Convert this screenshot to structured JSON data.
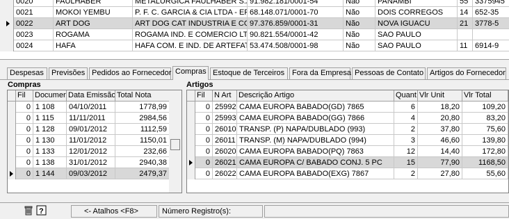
{
  "top_grid": {
    "rows": [
      {
        "code": "0020",
        "name": "FAULHABER",
        "razao": "METALURGICA FAULHABER S.A.",
        "cnpj": "91.982.181/0001-54",
        "flag": "Não",
        "city": "PANAMBI",
        "num": "55",
        "phone": "3375945",
        "selected": false
      },
      {
        "code": "0021",
        "name": "MOKOI YEMBU",
        "razao": "P. F. C. GARCIA & CIA LTDA - EPP",
        "cnpj": "68.148.071/0001-70",
        "flag": "Não",
        "city": "DOIS CORREGOS",
        "num": "14",
        "phone": "652-35",
        "selected": false
      },
      {
        "code": "0022",
        "name": "ART DOG",
        "razao": "ART DOG CAT INDUSTRIA E COMER",
        "cnpj": "97.376.859/0001-31",
        "flag": "Não",
        "city": "NOVA IGUACU",
        "num": "21",
        "phone": "3778-5",
        "selected": true
      },
      {
        "code": "0023",
        "name": "ROGAMA",
        "razao": "ROGAMA IND. E COMERCIO LTDA",
        "cnpj": "90.821.554/0001-42",
        "flag": "Não",
        "city": "SAO PAULO",
        "num": "",
        "phone": "",
        "selected": false
      },
      {
        "code": "0024",
        "name": "HAFA",
        "razao": "HAFA COM. E IND. DE ARTEFATOS D",
        "cnpj": "53.474.508/0001-98",
        "flag": "Não",
        "city": "SAO PAULO",
        "num": "11",
        "phone": "6914-9",
        "selected": false
      }
    ]
  },
  "tabs": [
    {
      "label": "Despesas",
      "active": false
    },
    {
      "label": "Previsões",
      "active": false
    },
    {
      "label": "Pedidos ao Fornecedor",
      "active": false
    },
    {
      "label": "Compras",
      "active": true
    },
    {
      "label": "Estoque de Terceiros",
      "active": false
    },
    {
      "label": "Fora da Empresa",
      "active": false
    },
    {
      "label": "Pessoas de Contato",
      "active": false
    },
    {
      "label": "Artigos do Fornecedor",
      "active": false
    }
  ],
  "compras": {
    "title": "Compras",
    "headers": {
      "fil": "Fil",
      "doc": "Documer",
      "data": "Data Emissão",
      "total": "Total Nota"
    },
    "rows": [
      {
        "fil": "0",
        "doc": "1 108",
        "data": "04/10/2011",
        "total": "1778,99",
        "selected": false
      },
      {
        "fil": "0",
        "doc": "1 115",
        "data": "11/11/2011",
        "total": "2984,56",
        "selected": false
      },
      {
        "fil": "0",
        "doc": "1 128",
        "data": "09/01/2012",
        "total": "1112,59",
        "selected": false
      },
      {
        "fil": "0",
        "doc": "1 130",
        "data": "11/01/2012",
        "total": "1150,01",
        "selected": false
      },
      {
        "fil": "0",
        "doc": "1 133",
        "data": "12/01/2012",
        "total": "232,66",
        "selected": false
      },
      {
        "fil": "0",
        "doc": "1 138",
        "data": "31/01/2012",
        "total": "2940,38",
        "selected": false
      },
      {
        "fil": "0",
        "doc": "1 144",
        "data": "09/03/2012",
        "total": "2479,37",
        "selected": true
      }
    ]
  },
  "artigos": {
    "title": "Artigos",
    "headers": {
      "fil": "Fil",
      "nart": "N Art",
      "desc": "Descrição Artigo",
      "quant": "Quant",
      "unit": "Vlr Unit",
      "total": "Vlr Total"
    },
    "rows": [
      {
        "fil": "0",
        "nart": "25992",
        "desc": "CAMA EUROPA BABADO(GD) 7865",
        "quant": "6",
        "unit": "18,20",
        "total": "109,20",
        "selected": false
      },
      {
        "fil": "0",
        "nart": "25993",
        "desc": "CAMA EUROPA BABADO(GG) 7866",
        "quant": "4",
        "unit": "20,80",
        "total": "83,20",
        "selected": false
      },
      {
        "fil": "0",
        "nart": "26010",
        "desc": "TRANSP. (P) NAPA/DUBLADO (993)",
        "quant": "2",
        "unit": "37,80",
        "total": "75,60",
        "selected": false
      },
      {
        "fil": "0",
        "nart": "26011",
        "desc": "TRANSP. (M) NAPA/DUBLADO (994)",
        "quant": "3",
        "unit": "46,60",
        "total": "139,80",
        "selected": false
      },
      {
        "fil": "0",
        "nart": "26020",
        "desc": "CAMA EUROPA BABADO(PQ) 7863",
        "quant": "12",
        "unit": "14,40",
        "total": "172,80",
        "selected": false
      },
      {
        "fil": "0",
        "nart": "26021",
        "desc": "CAMA EUROPA C/ BABADO  CONJ. 5 PC",
        "quant": "15",
        "unit": "77,90",
        "total": "1168,50",
        "selected": true
      },
      {
        "fil": "0",
        "nart": "26022",
        "desc": "CAMA EUROPA  BABADO(EXG) 7867",
        "quant": "2",
        "unit": "27,80",
        "total": "55,60",
        "selected": false
      }
    ]
  },
  "status": {
    "shortcuts": "<- Atalhos <F8>",
    "registro": "Número Registro(s):"
  },
  "icons": [
    "trash-icon",
    "help-icon"
  ]
}
